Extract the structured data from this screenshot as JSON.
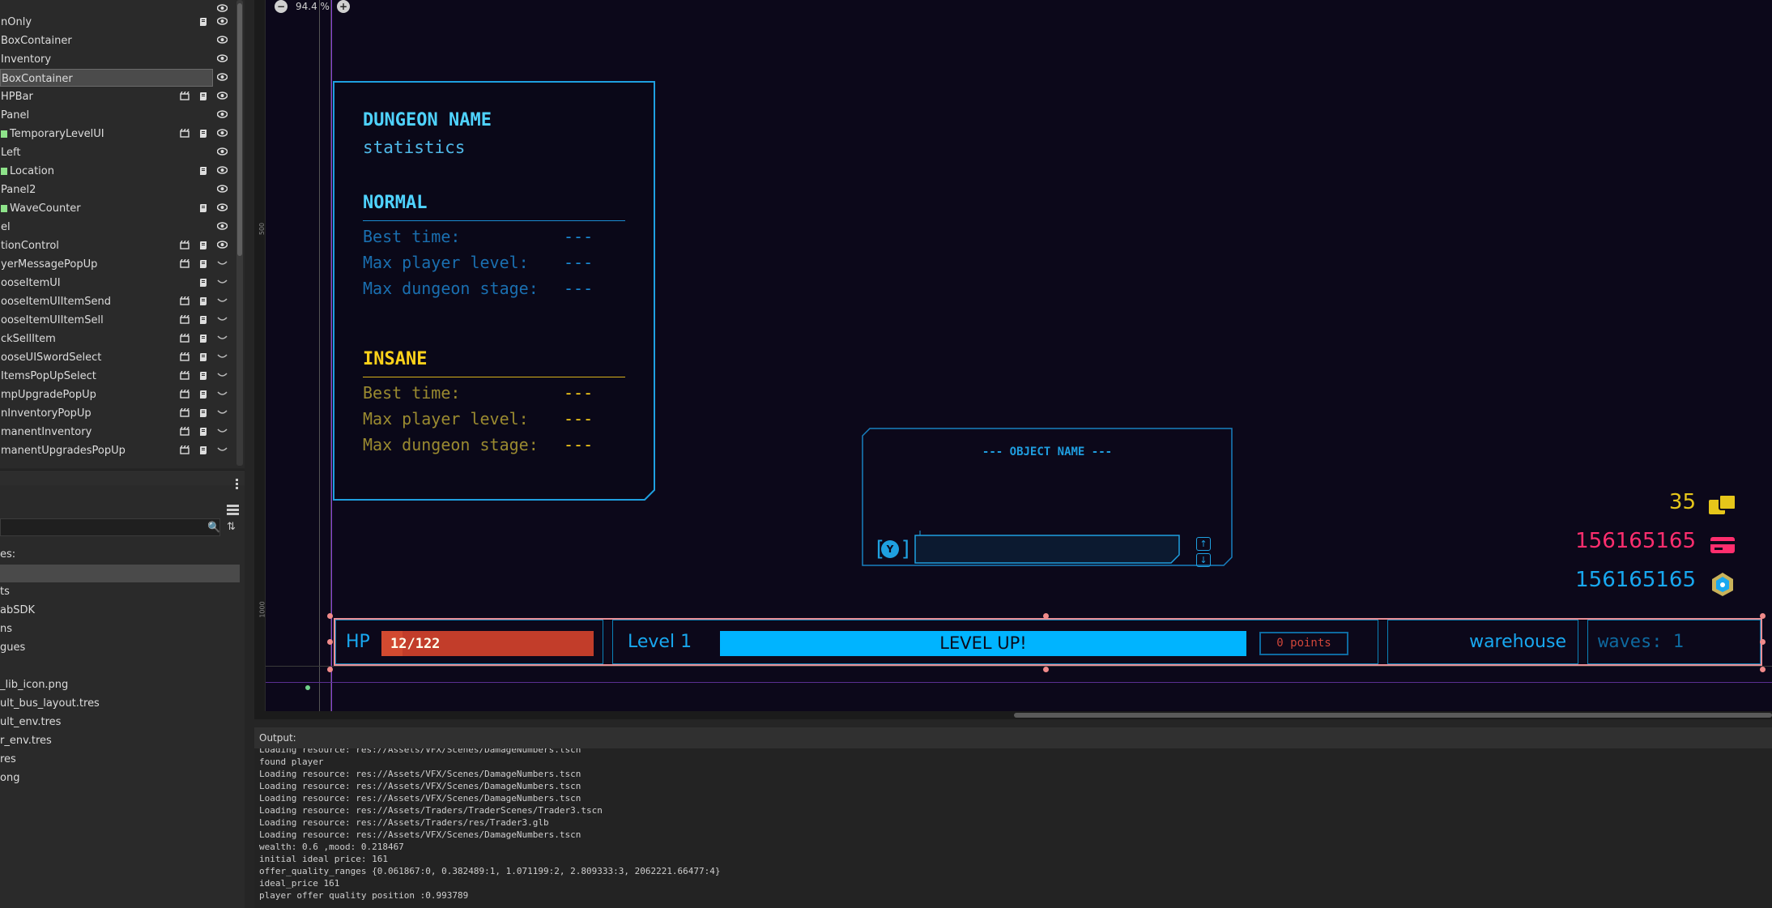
{
  "scene_tree": {
    "nodes": [
      {
        "label": "nOnly",
        "green": false,
        "script": true,
        "scene": false,
        "visibility": "visible"
      },
      {
        "label": "BoxContainer",
        "green": false,
        "script": false,
        "scene": false,
        "visibility": "visible"
      },
      {
        "label": "Inventory",
        "green": false,
        "script": false,
        "scene": false,
        "visibility": "visible"
      },
      {
        "label": "BoxContainer",
        "green": false,
        "script": false,
        "scene": false,
        "visibility": "visible",
        "selected": true
      },
      {
        "label": "HPBar",
        "green": false,
        "script": true,
        "scene": true,
        "visibility": "visible"
      },
      {
        "label": "Panel",
        "green": false,
        "script": false,
        "scene": false,
        "visibility": "visible"
      },
      {
        "label": "TemporaryLevelUI",
        "green": true,
        "script": true,
        "scene": true,
        "visibility": "visible"
      },
      {
        "label": "Left",
        "green": false,
        "script": false,
        "scene": false,
        "visibility": "visible"
      },
      {
        "label": "Location",
        "green": true,
        "script": true,
        "scene": false,
        "visibility": "visible"
      },
      {
        "label": "Panel2",
        "green": false,
        "script": false,
        "scene": false,
        "visibility": "visible"
      },
      {
        "label": "WaveCounter",
        "green": true,
        "script": true,
        "scene": false,
        "visibility": "visible"
      },
      {
        "label": "el",
        "green": false,
        "script": false,
        "scene": false,
        "visibility": "visible"
      },
      {
        "label": "tionControl",
        "green": false,
        "script": true,
        "scene": true,
        "visibility": "visible"
      },
      {
        "label": "yerMessagePopUp",
        "green": false,
        "script": true,
        "scene": true,
        "visibility": "hidden"
      },
      {
        "label": "ooseItemUI",
        "green": false,
        "script": true,
        "scene": false,
        "visibility": "hidden"
      },
      {
        "label": "ooseItemUIItemSend",
        "green": false,
        "script": true,
        "scene": true,
        "visibility": "hidden"
      },
      {
        "label": "ooseItemUIItemSell",
        "green": false,
        "script": true,
        "scene": true,
        "visibility": "hidden"
      },
      {
        "label": "ckSellItem",
        "green": false,
        "script": true,
        "scene": true,
        "visibility": "hidden"
      },
      {
        "label": "ooseUISwordSelect",
        "green": false,
        "script": true,
        "scene": true,
        "visibility": "hidden"
      },
      {
        "label": "ItemsPopUpSelect",
        "green": false,
        "script": true,
        "scene": true,
        "visibility": "hidden"
      },
      {
        "label": "mpUpgradePopUp",
        "green": false,
        "script": true,
        "scene": true,
        "visibility": "hidden"
      },
      {
        "label": "nInventoryPopUp",
        "green": false,
        "script": true,
        "scene": true,
        "visibility": "hidden"
      },
      {
        "label": "manentInventory",
        "green": false,
        "script": true,
        "scene": true,
        "visibility": "hidden"
      },
      {
        "label": "manentUpgradesPopUp",
        "green": false,
        "script": true,
        "scene": true,
        "visibility": "hidden"
      }
    ]
  },
  "filesystem": {
    "label_favorites": "es:",
    "items": [
      "ts",
      "abSDK",
      "ns",
      "gues",
      "_lib_icon.png",
      "ult_bus_layout.tres",
      "ult_env.tres",
      "r_env.tres",
      "res",
      "ong"
    ]
  },
  "viewport": {
    "zoom": "94.4 %",
    "ruler_marks": [
      "500",
      "1000"
    ]
  },
  "stats_panel": {
    "dungeon_name": "DUNGEON NAME",
    "subtitle": "statistics",
    "normal": {
      "heading": "NORMAL",
      "rows": [
        {
          "label": "Best time:",
          "value": "---"
        },
        {
          "label": "Max player level:",
          "value": "---"
        },
        {
          "label": "Max dungeon stage:",
          "value": "---"
        }
      ]
    },
    "insane": {
      "heading": "INSANE",
      "rows": [
        {
          "label": "Best time:",
          "value": "---"
        },
        {
          "label": "Max player level:",
          "value": "---"
        },
        {
          "label": "Max dungeon stage:",
          "value": "---"
        }
      ]
    }
  },
  "object_panel": {
    "title": "--- OBJECT NAME ---",
    "key_hint": "Y"
  },
  "resources": [
    {
      "value": "35",
      "color": "#e6c61a",
      "icon": "coins-icon"
    },
    {
      "value": "156165165",
      "color": "#ff2e6e",
      "icon": "card-icon"
    },
    {
      "value": "156165165",
      "color": "#18a8f0",
      "icon": "crystal-icon"
    }
  ],
  "hud_bar": {
    "hp_label": "HP",
    "hp_text": "12/122",
    "hp_fraction": 0.0984,
    "level_label": "Level 1",
    "level_up": "LEVEL UP!",
    "points": "0 points",
    "location": "warehouse",
    "waves": "waves: 1"
  },
  "output": {
    "title": "Output:",
    "lines": [
      "Loading resource: res://Assets/VFX/Scenes/DamageNumbers.tscn",
      "found player",
      "Loading resource: res://Assets/VFX/Scenes/DamageNumbers.tscn",
      "Loading resource: res://Assets/VFX/Scenes/DamageNumbers.tscn",
      "Loading resource: res://Assets/VFX/Scenes/DamageNumbers.tscn",
      "Loading resource: res://Assets/Traders/TraderScenes/Trader3.tscn",
      "Loading resource: res://Assets/Traders/res/Trader3.glb",
      "Loading resource: res://Assets/VFX/Scenes/DamageNumbers.tscn",
      "wealth: 0.6 ,mood: 0.218467",
      "initial ideal price: 161",
      "offer_quality_ranges {0.061867:0, 0.382489:1, 1.071199:2, 2.809333:3, 2062221.66477:4}",
      "ideal_price 161",
      "player offer quality position :0.993789"
    ]
  },
  "colors": {
    "cyan": "#4fd3ff",
    "blue": "#1a6fb0",
    "yellow": "#ffd21a",
    "olive": "#9a8a30",
    "hp_red": "#c23d2a",
    "level_fill": "#00b4ff",
    "selection": "#e98f97",
    "bg": "#0c081a"
  }
}
